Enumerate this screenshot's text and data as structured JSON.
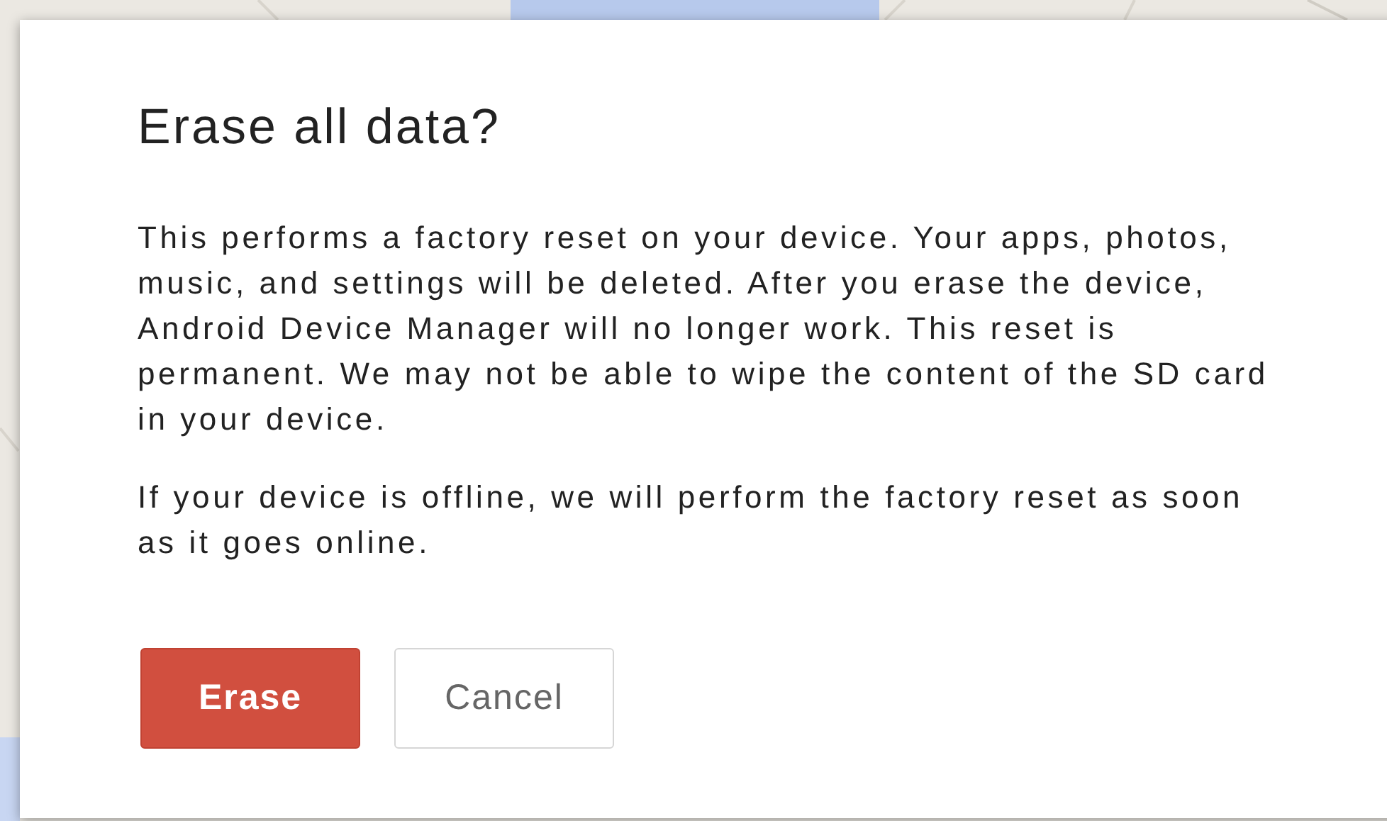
{
  "dialog": {
    "title": "Erase all data?",
    "paragraphs": [
      "This performs a factory reset on your device. Your apps, photos, music, and settings will be deleted. After you erase the device, Android Device Manager will no longer work. This reset is permanent. We may not be able to wipe the content of the SD card in your device.",
      "If your device is offline, we will perform the factory reset as soon as it goes online."
    ],
    "buttons": [
      {
        "label": "Erase",
        "kind": "primary"
      },
      {
        "label": "Cancel",
        "kind": "secondary"
      }
    ]
  }
}
